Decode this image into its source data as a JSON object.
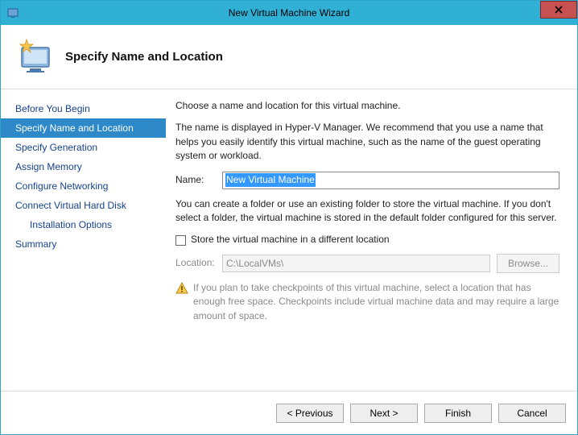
{
  "window": {
    "title": "New Virtual Machine Wizard"
  },
  "header": {
    "title": "Specify Name and Location"
  },
  "sidebar": {
    "steps": [
      {
        "label": "Before You Begin",
        "selected": false,
        "indent": false
      },
      {
        "label": "Specify Name and Location",
        "selected": true,
        "indent": false
      },
      {
        "label": "Specify Generation",
        "selected": false,
        "indent": false
      },
      {
        "label": "Assign Memory",
        "selected": false,
        "indent": false
      },
      {
        "label": "Configure Networking",
        "selected": false,
        "indent": false
      },
      {
        "label": "Connect Virtual Hard Disk",
        "selected": false,
        "indent": false
      },
      {
        "label": "Installation Options",
        "selected": false,
        "indent": true
      },
      {
        "label": "Summary",
        "selected": false,
        "indent": false
      }
    ]
  },
  "content": {
    "intro": "Choose a name and location for this virtual machine.",
    "name_help": "The name is displayed in Hyper-V Manager. We recommend that you use a name that helps you easily identify this virtual machine, such as the name of the guest operating system or workload.",
    "name_label": "Name:",
    "name_value": "New Virtual Machine",
    "folder_help": "You can create a folder or use an existing folder to store the virtual machine. If you don't select a folder, the virtual machine is stored in the default folder configured for this server.",
    "store_checkbox_label": "Store the virtual machine in a different location",
    "store_checkbox_checked": false,
    "location_label": "Location:",
    "location_value": "C:\\LocalVMs\\",
    "browse_label": "Browse...",
    "warning_text": "If you plan to take checkpoints of this virtual machine, select a location that has enough free space. Checkpoints include virtual machine data and may require a large amount of space."
  },
  "footer": {
    "previous": "< Previous",
    "next": "Next >",
    "finish": "Finish",
    "cancel": "Cancel"
  }
}
